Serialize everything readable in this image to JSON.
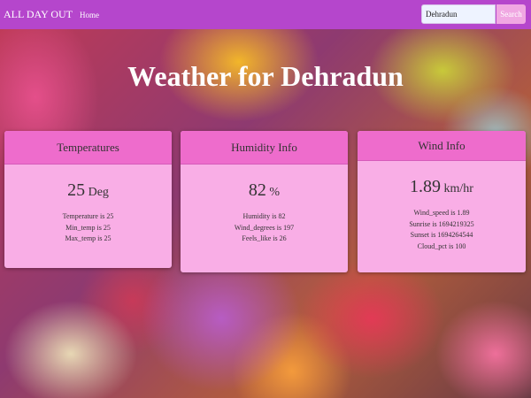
{
  "header": {
    "brand": "ALL DAY OUT",
    "nav_home": "Home",
    "search_value": "Dehradun",
    "search_button": "Search"
  },
  "page": {
    "title": "Weather for Dehradun"
  },
  "cards": {
    "temperatures": {
      "title": "Temperatures",
      "value": "25",
      "unit": "Deg",
      "lines": [
        "Temperature is 25",
        "Min_temp is 25",
        "Max_temp is 25"
      ]
    },
    "humidity": {
      "title": "Humidity Info",
      "value": "82",
      "unit": "%",
      "lines": [
        "Humidity is 82",
        "Wind_degrees is 197",
        "Feels_like is 26"
      ]
    },
    "wind": {
      "title": "Wind Info",
      "value": "1.89",
      "unit": "km/hr",
      "lines": [
        "Wind_speed is 1.89",
        "Sunrise is 1694219325",
        "Sunset is 1694264544",
        "Cloud_pct is 100"
      ]
    }
  },
  "colors": {
    "navbar": "#b546cc",
    "card_header": "#ee6ccc",
    "card_body": "#f9aee6",
    "search_button": "#f0a7e2"
  }
}
